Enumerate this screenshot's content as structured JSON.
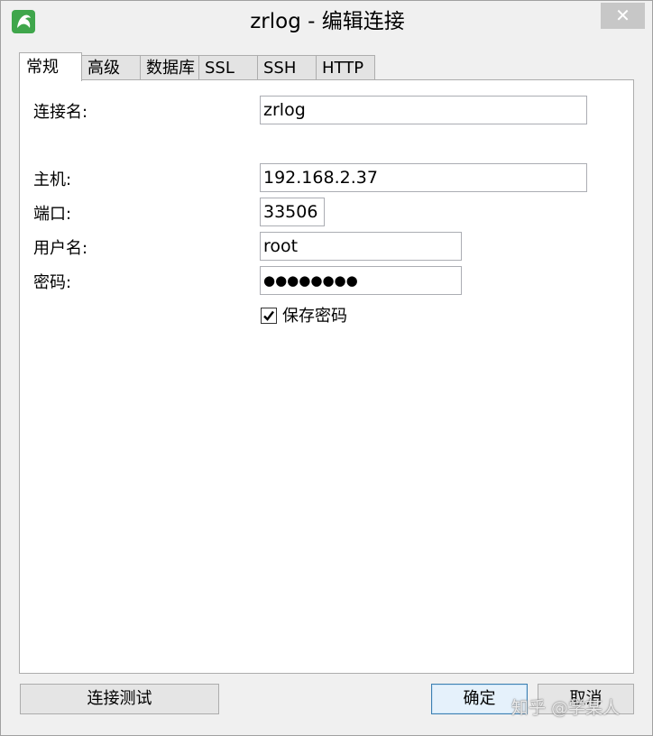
{
  "window": {
    "title": "zrlog - 编辑连接",
    "close_glyph": "✕"
  },
  "tabs": [
    {
      "label": "常规",
      "active": true
    },
    {
      "label": "高级",
      "active": false
    },
    {
      "label": "数据库",
      "active": false
    },
    {
      "label": "SSL",
      "active": false
    },
    {
      "label": "SSH",
      "active": false
    },
    {
      "label": "HTTP",
      "active": false
    }
  ],
  "form": {
    "connection_name": {
      "label": "连接名:",
      "value": "zrlog"
    },
    "host": {
      "label": "主机:",
      "value": "192.168.2.37"
    },
    "port": {
      "label": "端口:",
      "value": "33506"
    },
    "username": {
      "label": "用户名:",
      "value": "root"
    },
    "password": {
      "label": "密码:",
      "value": "●●●●●●●●"
    },
    "save_password": {
      "label": "保存密码",
      "checked": true
    }
  },
  "buttons": {
    "test": "连接测试",
    "ok": "确定",
    "cancel": "取消"
  },
  "watermark": "知乎 @学某人",
  "colors": {
    "app_icon": "#3fa64b",
    "close_button": "#c7c7c7",
    "default_button_border": "#3c7fb1"
  }
}
